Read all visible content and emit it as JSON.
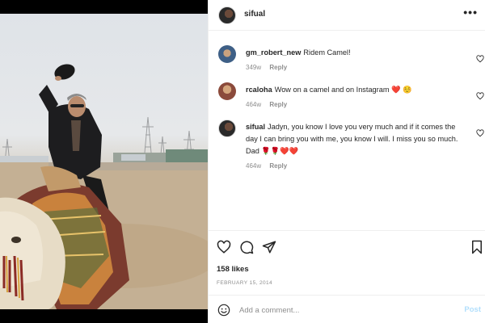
{
  "post": {
    "username": "sifual",
    "likes": "158 likes",
    "date": "FEBRUARY 15, 2014"
  },
  "comments": [
    {
      "username": "gm_robert_new",
      "text": "Ridem Camel!",
      "age": "349w",
      "reply": "Reply"
    },
    {
      "username": "rcaloha",
      "text": "Wow on a camel and on Instagram ❤️ ☺️",
      "age": "464w",
      "reply": "Reply"
    },
    {
      "username": "sifual",
      "text": "Jadyn, you know I love you very much and if it comes the day I can bring you with me, you know I will. I miss you so much. Dad 🌹🌹❤️❤️",
      "age": "464w",
      "reply": "Reply"
    }
  ],
  "add_comment": {
    "placeholder": "Add a comment...",
    "post_label": "Post"
  },
  "icons": {
    "header_more": "more-options-icon",
    "like": "heart-icon",
    "comment": "comment-icon",
    "share": "share-icon",
    "save": "bookmark-icon",
    "emoji": "emoji-icon"
  },
  "colors": {
    "post_button": "#b2dffc",
    "secondary_text": "#8e8e8e",
    "primary_text": "#262626"
  }
}
